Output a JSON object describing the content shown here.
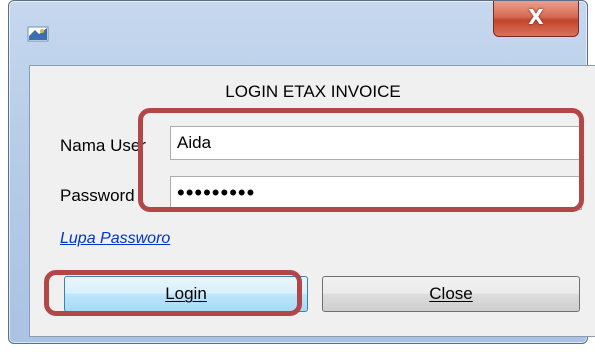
{
  "window": {
    "title": "",
    "close_glyph": "X",
    "app_icon": "etax-app-icon",
    "close_icon": "close-icon"
  },
  "form": {
    "heading": "LOGIN ETAX INVOICE",
    "username_label": "Nama User",
    "username_value": "Aida",
    "password_label": "Password",
    "password_value": "•••••••••",
    "forgot_link": "Lupa Passworo"
  },
  "buttons": {
    "login_label": "Login",
    "close_label": "Close"
  },
  "colors": {
    "highlight": "#b34747",
    "link": "#0033cc",
    "close_button": "#c2462c"
  }
}
